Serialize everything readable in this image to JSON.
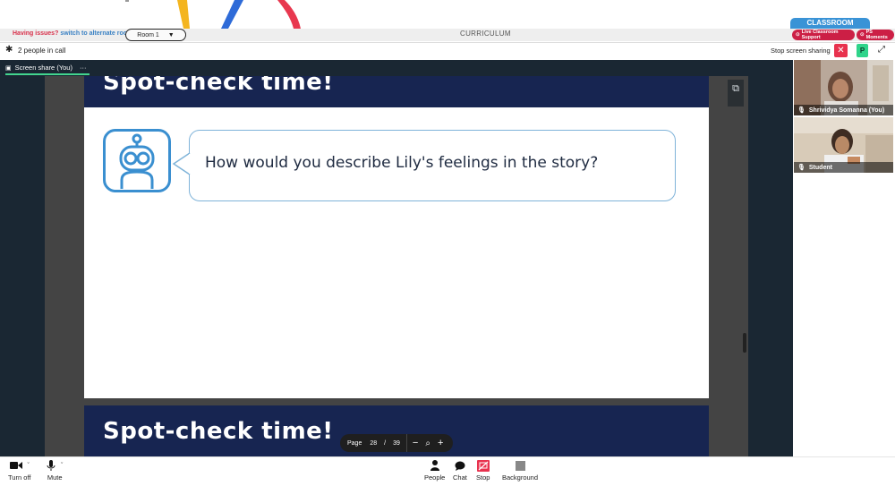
{
  "header": {
    "issues_text": "Having issues?",
    "alternate_link": "switch to alternate room",
    "room_value": "Room 1",
    "curriculum_label": "CURRICULUM",
    "classroom_label": "CLASSROOM",
    "live_support_label": "Live Classroom Support",
    "ps_moments_label": "PS Moments"
  },
  "call": {
    "people_count": "2 people in call",
    "stop_sharing_label": "Stop screen sharing",
    "close_symbol": "✕",
    "p_badge": "P"
  },
  "share_tab": {
    "label": "Screen share (You)",
    "more": "···"
  },
  "slide": {
    "title": "Spot-check time!",
    "question": "How would you describe Lily's feelings in the story?",
    "next_title": "Spot-check time!"
  },
  "pager": {
    "page_label": "Page",
    "current_page": "28",
    "separator": "/",
    "total_pages": "39"
  },
  "participants": [
    {
      "name": "Shrividya Somanna (You)"
    },
    {
      "name": "Student"
    }
  ],
  "toolbar": {
    "turn_off_label": "Turn off",
    "mute_label": "Mute",
    "people_label": "People",
    "chat_label": "Chat",
    "stop_label": "Stop",
    "background_label": "Background"
  },
  "colors": {
    "accent_green": "#43d58f",
    "danger_red": "#e8324e",
    "slide_navy": "#172551",
    "robot_blue": "#3a8fd0",
    "classroom_blue": "#3a93d6"
  }
}
